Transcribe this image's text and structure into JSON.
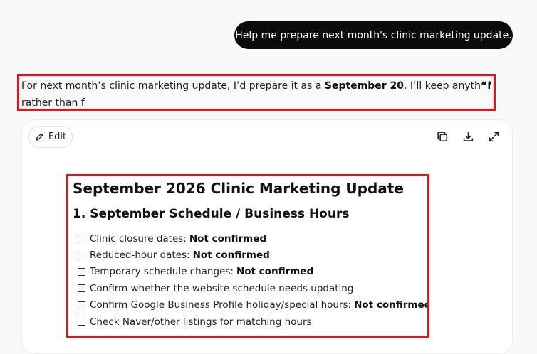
{
  "user_message": "Help me prepare next month's clinic marketing update.",
  "assistant": {
    "line1_pre": "For next month’s clinic marketing update, I’d prepare it as a ",
    "line1_bold": "September 20",
    "line1_mid": ". I’ll keep anyth",
    "line1_bold2": "“Not conf",
    "line2": "rather than f"
  },
  "toolbar": {
    "edit_label": "Edit",
    "icons": [
      "pencil-icon",
      "copy-icon",
      "download-icon",
      "expand-icon"
    ]
  },
  "document": {
    "title": "September 2026 Clinic Marketing Update",
    "section_title": "1. September Schedule / Business Hours",
    "items": [
      {
        "label": "Clinic closure dates:",
        "status": "Not confirmed"
      },
      {
        "label": "Reduced-hour dates:",
        "status": "Not confirmed"
      },
      {
        "label": "Temporary schedule changes:",
        "status": "Not confirmed"
      },
      {
        "label": "Confirm whether the website schedule needs updating",
        "status": ""
      },
      {
        "label": "Confirm Google Business Profile holiday/special hours:",
        "status": "Not confirmed"
      },
      {
        "label": "Check Naver/other listings for matching hours",
        "status": ""
      }
    ]
  },
  "colors": {
    "highlight_border": "#e0161f",
    "user_bubble": "#0b0b0b",
    "background": "#f9f9f9"
  }
}
